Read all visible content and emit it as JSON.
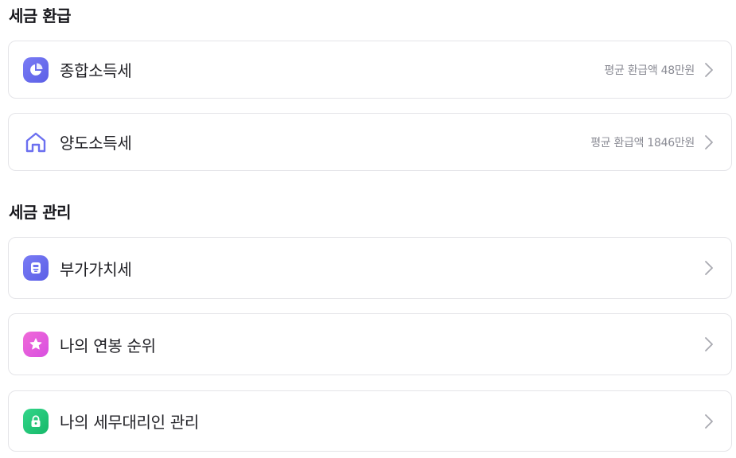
{
  "sections": [
    {
      "title": "세금 환급",
      "items": [
        {
          "label": "종합소득세",
          "sub": "평균 환급액 48만원",
          "icon": "pie-chart-icon"
        },
        {
          "label": "양도소득세",
          "sub": "평균 환급액 1846만원",
          "icon": "house-icon"
        }
      ]
    },
    {
      "title": "세금 관리",
      "items": [
        {
          "label": "부가가치세",
          "sub": "",
          "icon": "receipt-icon"
        },
        {
          "label": "나의 연봉 순위",
          "sub": "",
          "icon": "star-icon"
        },
        {
          "label": "나의 세무대리인 관리",
          "sub": "",
          "icon": "lock-icon"
        }
      ]
    }
  ],
  "colors": {
    "indigo": "#6b6ff0",
    "pink": "#e85fd8",
    "green": "#22c67a",
    "chevron": "#a8a9b0"
  }
}
